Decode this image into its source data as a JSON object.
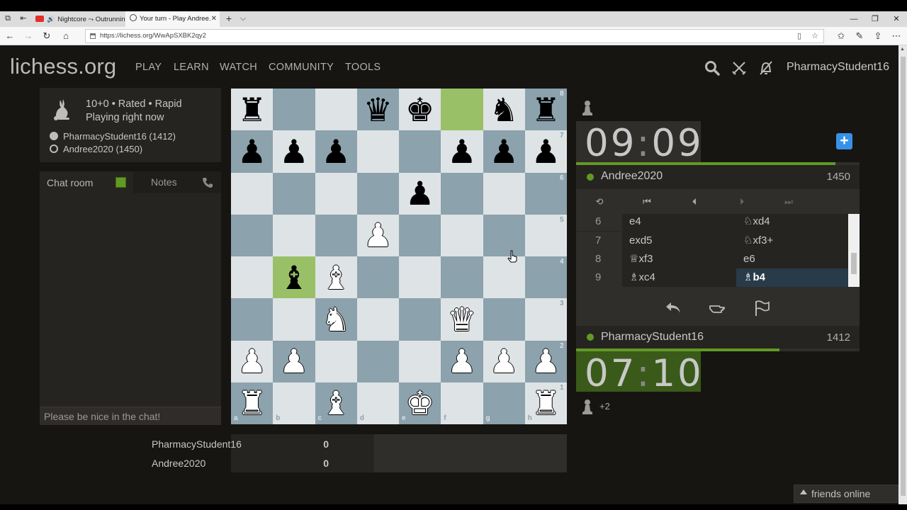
{
  "browser": {
    "tabs": [
      {
        "title": "Nightcore ⤳ Outrunnin"
      },
      {
        "title": "Your turn - Play Andree."
      }
    ],
    "url": "https://lichess.org/WwApSXBK2qy2",
    "new_tab_symbol": "+",
    "tab_list_symbol": "⌵"
  },
  "site": {
    "logo": "lichess.org",
    "nav": [
      "PLAY",
      "LEARN",
      "WATCH",
      "COMMUNITY",
      "TOOLS"
    ],
    "username": "PharmacyStudent16"
  },
  "game_info": {
    "setup": "10+0 • Rated • Rapid",
    "status": "Playing right now",
    "white_player": "PharmacyStudent16 (1412)",
    "black_player": "Andree2020 (1450)"
  },
  "chat": {
    "tab_chat": "Chat room",
    "tab_notes": "Notes",
    "placeholder": "Please be nice in the chat!"
  },
  "board": {
    "files": [
      "a",
      "b",
      "c",
      "d",
      "e",
      "f",
      "g",
      "h"
    ],
    "ranks": [
      "8",
      "7",
      "6",
      "5",
      "4",
      "3",
      "2",
      "1"
    ],
    "highlight_squares": [
      "f8",
      "b4"
    ],
    "pieces": [
      {
        "sq": "a8",
        "piece": "♜",
        "color": "b",
        "name": "black-rook"
      },
      {
        "sq": "d8",
        "piece": "♛",
        "color": "b",
        "name": "black-queen"
      },
      {
        "sq": "e8",
        "piece": "♚",
        "color": "b",
        "name": "black-king"
      },
      {
        "sq": "g8",
        "piece": "♞",
        "color": "b",
        "name": "black-knight"
      },
      {
        "sq": "h8",
        "piece": "♜",
        "color": "b",
        "name": "black-rook"
      },
      {
        "sq": "a7",
        "piece": "♟",
        "color": "b",
        "name": "black-pawn"
      },
      {
        "sq": "b7",
        "piece": "♟",
        "color": "b",
        "name": "black-pawn"
      },
      {
        "sq": "c7",
        "piece": "♟",
        "color": "b",
        "name": "black-pawn"
      },
      {
        "sq": "f7",
        "piece": "♟",
        "color": "b",
        "name": "black-pawn"
      },
      {
        "sq": "g7",
        "piece": "♟",
        "color": "b",
        "name": "black-pawn"
      },
      {
        "sq": "h7",
        "piece": "♟",
        "color": "b",
        "name": "black-pawn"
      },
      {
        "sq": "e6",
        "piece": "♟",
        "color": "b",
        "name": "black-pawn"
      },
      {
        "sq": "d5",
        "piece": "♟",
        "color": "w",
        "name": "white-pawn"
      },
      {
        "sq": "b4",
        "piece": "♝",
        "color": "b",
        "name": "black-bishop"
      },
      {
        "sq": "c4",
        "piece": "♝",
        "color": "w",
        "name": "white-bishop"
      },
      {
        "sq": "c3",
        "piece": "♞",
        "color": "w",
        "name": "white-knight"
      },
      {
        "sq": "f3",
        "piece": "♛",
        "color": "w",
        "name": "white-queen"
      },
      {
        "sq": "a2",
        "piece": "♟",
        "color": "w",
        "name": "white-pawn"
      },
      {
        "sq": "b2",
        "piece": "♟",
        "color": "w",
        "name": "white-pawn"
      },
      {
        "sq": "f2",
        "piece": "♟",
        "color": "w",
        "name": "white-pawn"
      },
      {
        "sq": "g2",
        "piece": "♟",
        "color": "w",
        "name": "white-pawn"
      },
      {
        "sq": "h2",
        "piece": "♟",
        "color": "w",
        "name": "white-pawn"
      },
      {
        "sq": "a1",
        "piece": "♜",
        "color": "w",
        "name": "white-rook"
      },
      {
        "sq": "c1",
        "piece": "♝",
        "color": "w",
        "name": "white-bishop"
      },
      {
        "sq": "e1",
        "piece": "♚",
        "color": "w",
        "name": "white-king"
      },
      {
        "sq": "h1",
        "piece": "♜",
        "color": "w",
        "name": "white-rook"
      }
    ]
  },
  "crosstable": [
    {
      "name": "PharmacyStudent16",
      "score": "0"
    },
    {
      "name": "Andree2020",
      "score": "0"
    }
  ],
  "opponent": {
    "clock_min": "09",
    "clock_sec": "09",
    "name": "Andree2020",
    "rating": "1450",
    "time_fraction": 0.915
  },
  "me": {
    "clock_min": "07",
    "clock_sec": "10",
    "name": "PharmacyStudent16",
    "rating": "1412",
    "time_fraction": 0.717,
    "material_diff": "+2"
  },
  "moves": [
    {
      "n": "6",
      "white": "e4",
      "black": "♘xd4"
    },
    {
      "n": "7",
      "white": "exd5",
      "black": "♘xf3+"
    },
    {
      "n": "8",
      "white": "♕xf3",
      "black": "e6"
    },
    {
      "n": "9",
      "white": "♗xc4",
      "black": "♗b4"
    }
  ],
  "footer": {
    "friends": "friends online"
  },
  "colors": {
    "accent_green": "#629924",
    "highlight": "#9ac067",
    "plus_time_blue": "#3692e7"
  }
}
